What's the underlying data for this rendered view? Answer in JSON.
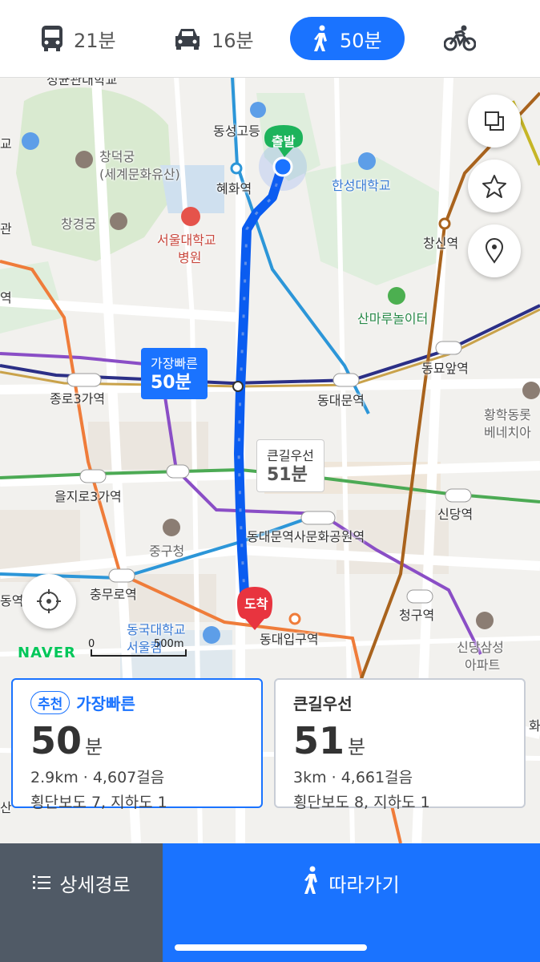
{
  "modes": [
    {
      "icon": "bus-icon",
      "label": "21분"
    },
    {
      "icon": "car-icon",
      "label": "16분"
    },
    {
      "icon": "walk-icon",
      "label": "50분",
      "active": true
    },
    {
      "icon": "bicycle-icon",
      "label": ""
    }
  ],
  "map": {
    "labels": {
      "univ_top": "성균관대학교",
      "school": "동성고등",
      "start_pin": "출발",
      "hyehwa": "혜화역",
      "hansung": "한성대학교",
      "changdeok": "창덕궁",
      "changdeok_sub": "(세계문화유산)",
      "changgyeong": "창경궁",
      "snuh1": "서울대학교",
      "snuh2": "병원",
      "changsin": "창신역",
      "sanmaru": "산마루놀이터",
      "dongmyo": "동묘앞역",
      "jongno3": "종로3가역",
      "dongdaemun": "동대문역",
      "hwanghak1": "황학동롯",
      "hwanghak2": "베네치아",
      "euljiro3": "을지로3가역",
      "sindang": "신당역",
      "ddp": "동대문역사문화공원역",
      "junggu": "중구청",
      "chungmuro": "충무로역",
      "cheonggu": "청구역",
      "dongguk1": "동국대학교",
      "dongguk2": "서울캠",
      "arrive_pin": "도착",
      "dongdae_ent": "동대입구역",
      "sindang_apt1": "신당삼성",
      "sindang_apt2": "아파트",
      "edge_left1": "교",
      "edge_left2": "관",
      "edge_left3": "역",
      "edge_left4": "동역",
      "edge_left5": "산",
      "edge_right1": "",
      "edge_right2": "화"
    },
    "bubble_fast": {
      "title": "가장빠른",
      "time": "50분"
    },
    "bubble_big": {
      "title": "큰길우선",
      "time": "51분"
    },
    "brand": "NAVER",
    "scale_zero": "0",
    "scale_label": "500m"
  },
  "routes": [
    {
      "badge": "추천",
      "title": "가장빠른",
      "time": "50",
      "unit": "분",
      "distance": "2.9km · 4,607걸음",
      "crossing": "횡단보도 7, 지하도 1"
    },
    {
      "badge": "",
      "title": "큰길우선",
      "time": "51",
      "unit": "분",
      "distance": "3km · 4,661걸음",
      "crossing": "횡단보도 8, 지하도 1"
    }
  ],
  "bottom": {
    "detail_label": "상세경로",
    "follow_label": "따라가기"
  },
  "colors": {
    "accent": "#1a73ff",
    "start": "#1db35b",
    "end": "#e8343f"
  }
}
